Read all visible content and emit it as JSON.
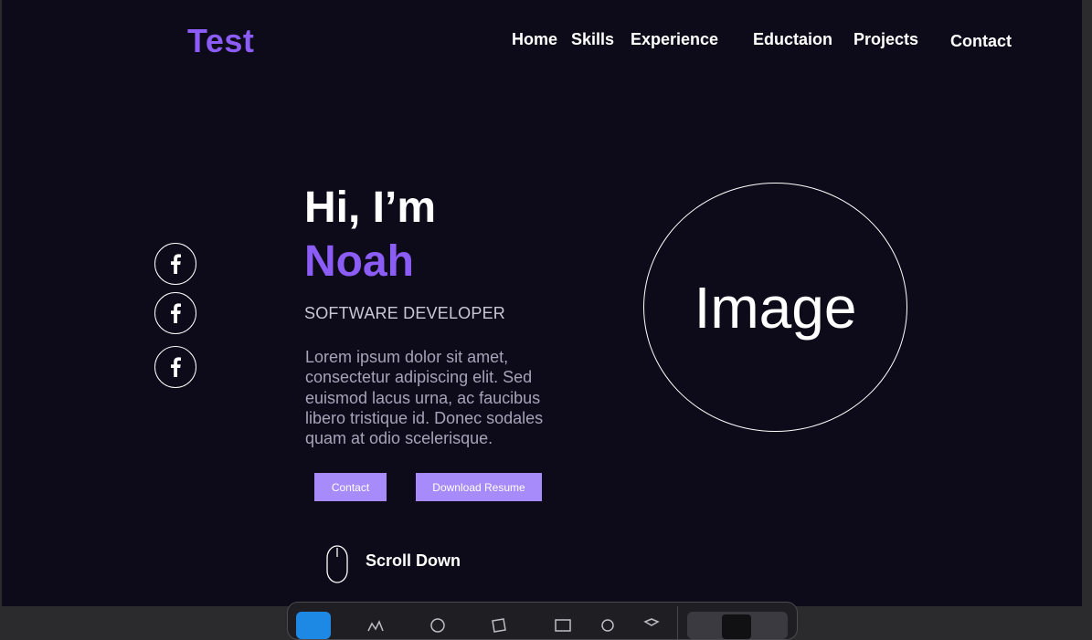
{
  "header": {
    "brand": "Test",
    "nav": [
      {
        "label": "Home"
      },
      {
        "label": "Skills"
      },
      {
        "label": "Experience"
      },
      {
        "label": "Eductaion"
      },
      {
        "label": "Projects"
      },
      {
        "label": "Contact"
      }
    ]
  },
  "social": {
    "icons": [
      "facebook-icon",
      "facebook-icon",
      "facebook-icon"
    ]
  },
  "hero": {
    "greeting": "Hi, I’m",
    "name": "Noah",
    "role": "SOFTWARE DEVELOPER",
    "bio": "Lorem ipsum dolor sit amet, consectetur adipiscing elit. Sed euismod lacus urna, ac faucibus libero tristique id. Donec sodales quam at odio scelerisque.",
    "contact_button": "Contact",
    "resume_button": "Download Resume",
    "scroll_label": "Scroll Down",
    "image_placeholder": "Image"
  },
  "colors": {
    "background": "#0d0b19",
    "accent": "#8b5cf6",
    "button": "#a78bfa",
    "text": "#ffffff",
    "muted_text": "#a7a3b8"
  }
}
